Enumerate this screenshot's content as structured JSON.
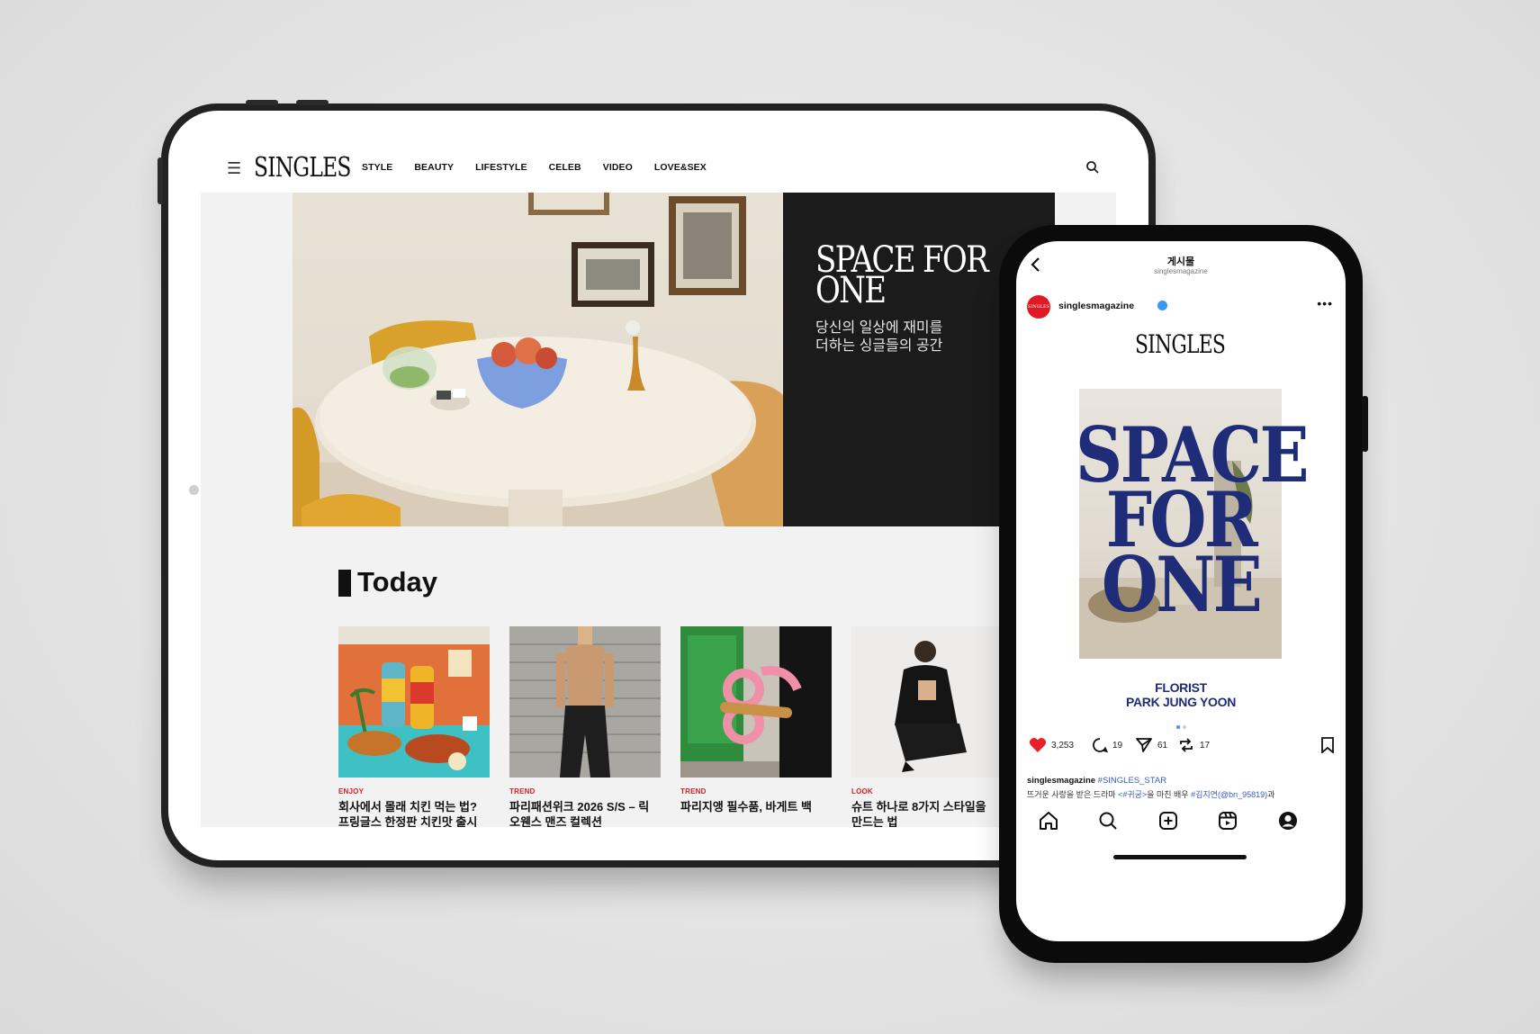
{
  "tablet": {
    "site": {
      "logo": "SINGLES",
      "nav": [
        "STYLE",
        "BEAUTY",
        "LIFESTYLE",
        "CELEB",
        "VIDEO",
        "LOVE&SEX"
      ],
      "icons": {
        "menu": "hamburger-icon",
        "search": "search-icon"
      },
      "hero": {
        "title_line1": "SPACE FOR",
        "title_line2": "ONE",
        "subtitle_line1": "당신의 일상에 재미를",
        "subtitle_line2": "더하는 싱글들의 공간"
      },
      "section_title": "Today",
      "cards": [
        {
          "category": "ENJOY",
          "title_line1": "회사에서 몰래 치킨 먹는 법?",
          "title_line2": "프링글스 한정판 치킨맛 출시"
        },
        {
          "category": "TREND",
          "title_line1": "파리패션위크 2026 S/S – 릭",
          "title_line2": "오웬스 맨즈 컬렉션"
        },
        {
          "category": "TREND",
          "title_line1": "파리지앵 필수품, 바게트 백",
          "title_line2": ""
        },
        {
          "category": "LOOK",
          "title_line1": "슈트 하나로 8가지 스타일을",
          "title_line2": "만드는 법"
        }
      ]
    }
  },
  "phone": {
    "header": {
      "title": "게시물",
      "subtitle": "singlesmagazine"
    },
    "post": {
      "avatar_text": "SINGLES",
      "username": "singlesmagazine",
      "verified": true,
      "image": {
        "logo": "SINGLES",
        "headline": [
          "SPACE",
          "FOR",
          "ONE"
        ],
        "sub_line1": "FLORIST",
        "sub_line2": "PARK JUNG YOON"
      },
      "carousel": {
        "count": 2,
        "active_index": 0
      },
      "likes": "3,253",
      "comments": "19",
      "shares": "61",
      "reposts": "17",
      "caption_user": "singlesmagazine",
      "caption_tag": "#SINGLES_STAR",
      "caption_line2_a": "뜨거운 사랑을 받은 드라마 ",
      "caption_line2_tag1": "<#귀궁>",
      "caption_line2_b": "을 마친 배우 ",
      "caption_line2_tag2": "#김지연",
      "caption_line2_tag3": "(@bn_95819)",
      "caption_line2_c": "과"
    },
    "colors": {
      "accent": "#1f2c78",
      "link": "#3b5db8",
      "like": "#e8202a",
      "verified": "#3897f0"
    },
    "bottom_nav": [
      "home-icon",
      "search-icon",
      "create-icon",
      "reels-icon",
      "profile-icon"
    ]
  }
}
